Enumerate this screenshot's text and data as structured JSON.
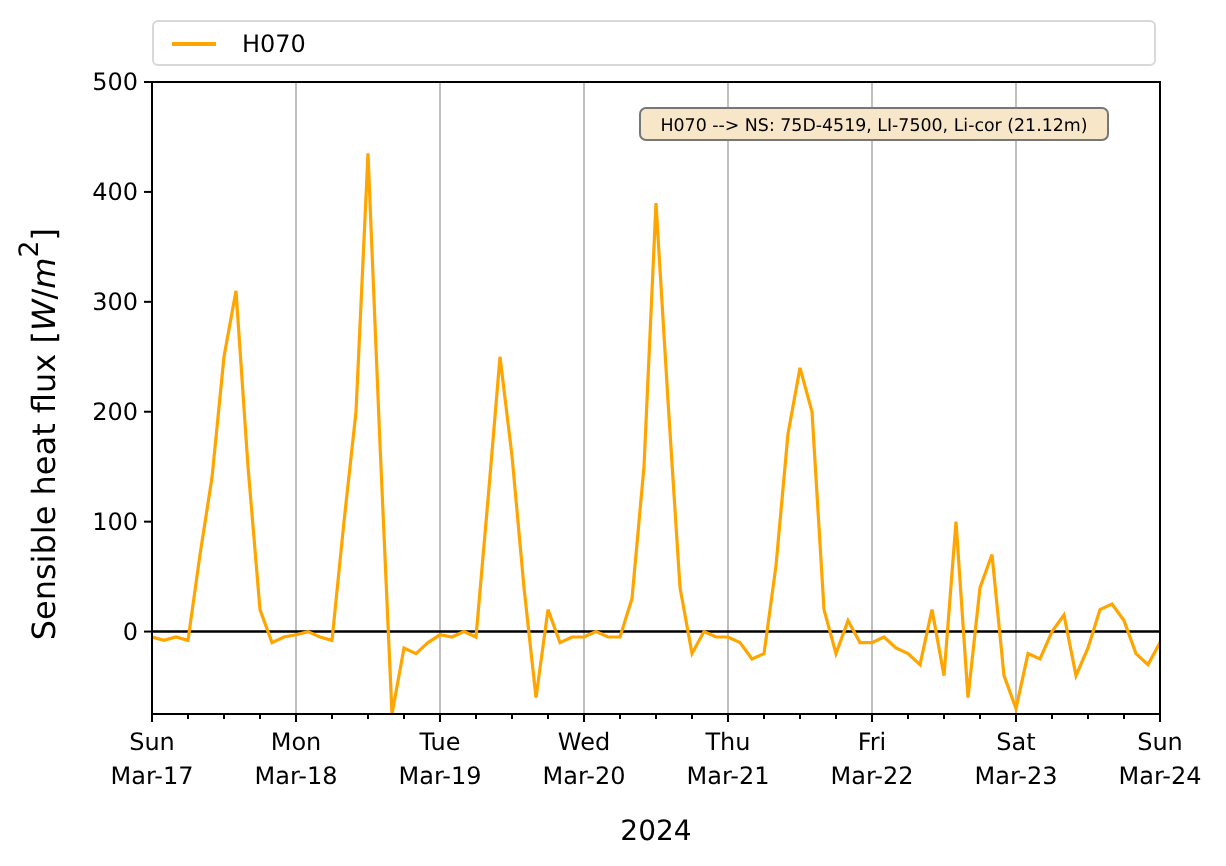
{
  "annotation": "H070 --> NS: 75D-4519, LI-7500, Li-cor (21.12m)",
  "chart_data": {
    "type": "line",
    "xlabel": "2024",
    "ylabel": "Sensible heat flux [*W*/*m*$^{2}$]",
    "categories": [
      "Sun Mar-17",
      null,
      null,
      null,
      null,
      null,
      null,
      null,
      null,
      null,
      null,
      null,
      "Mon Mar-18",
      null,
      null,
      null,
      null,
      null,
      null,
      null,
      null,
      null,
      null,
      null,
      "Tue Mar-19",
      null,
      null,
      null,
      null,
      null,
      null,
      null,
      null,
      null,
      null,
      null,
      "Wed Mar-20",
      null,
      null,
      null,
      null,
      null,
      null,
      null,
      null,
      null,
      null,
      null,
      "Thu Mar-21",
      null,
      null,
      null,
      null,
      null,
      null,
      null,
      null,
      null,
      null,
      null,
      "Fri Mar-22",
      null,
      null,
      null,
      null,
      null,
      null,
      null,
      null,
      null,
      null,
      null,
      "Sat Mar-23",
      null,
      null,
      null,
      null,
      null,
      null,
      null,
      null,
      null,
      null,
      null,
      "Sun Mar-24"
    ],
    "series": [
      {
        "name": "H070",
        "color": "#ffa500",
        "values": [
          -5,
          -8,
          -5,
          -8,
          70,
          140,
          250,
          310,
          150,
          20,
          -10,
          -5,
          -3,
          0,
          -5,
          -8,
          100,
          200,
          435,
          170,
          -75,
          -15,
          -20,
          -10,
          -3,
          -5,
          0,
          -5,
          120,
          250,
          160,
          40,
          -60,
          20,
          -10,
          -5,
          -5,
          0,
          -5,
          -5,
          30,
          150,
          390,
          210,
          40,
          -20,
          0,
          -5,
          -5,
          -10,
          -25,
          -20,
          60,
          180,
          240,
          200,
          20,
          -20,
          10,
          -10,
          -10,
          -5,
          -15,
          -20,
          -30,
          20,
          -40,
          100,
          -60,
          40,
          70,
          -40,
          -70,
          -20,
          -25,
          0,
          15,
          -40,
          -15,
          20,
          25,
          10,
          -20,
          -30,
          -10
        ]
      }
    ],
    "ylim": [
      -75,
      500
    ],
    "grid": true,
    "yticks": [
      0,
      100,
      200,
      300,
      400,
      500
    ]
  }
}
